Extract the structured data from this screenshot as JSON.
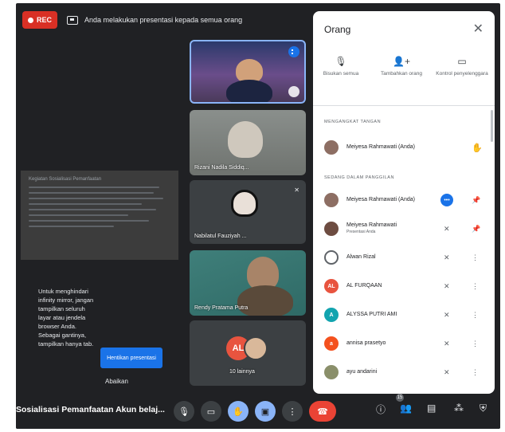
{
  "recording": {
    "label": "REC"
  },
  "presenting": {
    "text": "Anda melakukan presentasi kepada semua orang"
  },
  "slide": {
    "title": "Kegiatan Sosialisasi Pemanfaatan"
  },
  "notice": {
    "message": "Untuk menghindari infinity mirror, jangan tampilkan seluruh layar atau jendela browser Anda. Sebagai gantinya, tampilkan hanya tab.",
    "stop_button": "Hentikan presentasi",
    "ignore_button": "Abaikan"
  },
  "tiles": [
    {
      "name": "",
      "badge": "speaking"
    },
    {
      "name": "Rizani Nadila Siddiq..."
    },
    {
      "name": "Nabilatul Fauziyah ..."
    },
    {
      "name": "Rendy Pratama Putra"
    },
    {
      "name": "10 lainnya",
      "avatar_letters": "AL"
    }
  ],
  "toolbar": {
    "meeting_title": "Sosialisasi Pemanfaatan Akun belaj...",
    "participant_count": "15"
  },
  "panel": {
    "title": "Orang",
    "actions": [
      {
        "icon": "mic-off-icon",
        "label": "Bisukan semua"
      },
      {
        "icon": "add-person-icon",
        "label": "Tambahkan orang"
      },
      {
        "icon": "video-icon",
        "label": "Kontrol penyelenggara"
      }
    ],
    "section_raised": "MENGANGKAT TANGAN",
    "raised_hand_row": {
      "name": "Meiyesa Rahmawati (Anda)"
    },
    "section_in_call": "SEDANG DALAM PANGGILAN",
    "participants": [
      {
        "name": "Meiyesa Rahmawati (Anda)",
        "sub": "",
        "avatar_color": "#8d6e63",
        "initial": ""
      },
      {
        "name": "Meiyesa Rahmawati",
        "sub": "Presentasi Anda",
        "avatar_color": "#6d4c41",
        "initial": ""
      },
      {
        "name": "Alwan Rizal",
        "sub": "",
        "avatar_color": "#ffffff",
        "initial": ""
      },
      {
        "name": "AL FURQAAN",
        "sub": "",
        "avatar_color": "#e8543f",
        "initial": "AL"
      },
      {
        "name": "ALYSSA PUTRI AMI",
        "sub": "",
        "avatar_color": "#12a4af",
        "initial": "A"
      },
      {
        "name": "annisa prasetyo",
        "sub": "",
        "avatar_color": "#f4511e",
        "initial": "a"
      },
      {
        "name": "ayu andarini",
        "sub": "",
        "avatar_color": "#8a8f6a",
        "initial": ""
      }
    ]
  }
}
